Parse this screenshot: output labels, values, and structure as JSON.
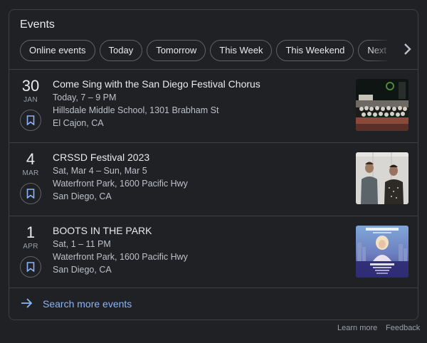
{
  "card": {
    "title": "Events"
  },
  "chips": [
    "Online events",
    "Today",
    "Tomorrow",
    "This Week",
    "This Weekend",
    "Next Week"
  ],
  "events": [
    {
      "day": "30",
      "month": "JAN",
      "title": "Come Sing with the San Diego Festival Chorus",
      "time": "Today, 7 – 9 PM",
      "venue": "Hillsdale Middle School, 1301 Brabham St",
      "city": "El Cajon, CA",
      "image": "chorus-concert-photo"
    },
    {
      "day": "4",
      "month": "MAR",
      "title": "CRSSD Festival 2023",
      "time": "Sat, Mar 4 – Sun, Mar 5",
      "venue": "Waterfront Park, 1600 Pacific Hwy",
      "city": "San Diego, CA",
      "image": "two-artists-photo"
    },
    {
      "day": "1",
      "month": "APR",
      "title": "BOOTS IN THE PARK",
      "time": "Sat, 1 – 11 PM",
      "venue": "Waterfront Park, 1600 Pacific Hwy",
      "city": "San Diego, CA",
      "image": "boots-in-the-park-poster"
    }
  ],
  "search_more": {
    "label": "Search more events",
    "icon": "arrow-right-icon",
    "color": "#8ab4f8"
  },
  "footer": {
    "learn_more": "Learn more",
    "feedback": "Feedback"
  },
  "colors": {
    "background": "#202124",
    "border": "#3c4043",
    "text": "#e8eaed",
    "secondary_text": "#bdc1c6",
    "link": "#8ab4f8"
  }
}
